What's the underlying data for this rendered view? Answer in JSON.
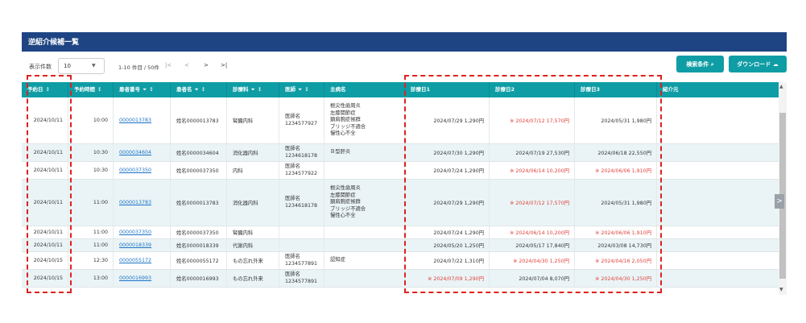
{
  "header": {
    "title": "逆紹介候補一覧"
  },
  "toolbar": {
    "page_size_label": "表示件数",
    "page_size_value": "10",
    "range_text": "1-10 件目 / 50件",
    "search_button": "検索条件",
    "download_button": "ダウンロード"
  },
  "columns": [
    "予約日",
    "予約時間",
    "患者番号",
    "患者名",
    "診療科",
    "医師",
    "主病名",
    "診療日1",
    "診療日2",
    "診療日3",
    "紹介元"
  ],
  "rows": [
    {
      "date": "2024/10/11",
      "time": "10:00",
      "pid": "0000013783",
      "name": "姓名0000013783",
      "dept": "腎臓内科",
      "doctor": [
        "医師名",
        "1234577927"
      ],
      "diag": [
        "根尖性歯周炎",
        "左膝関節症",
        "頚肩腕症候群",
        "ブリッジ不適合",
        "慢性心不全"
      ],
      "d1": "2024/07/29 1,290円",
      "d1r": false,
      "d2": "※ 2024/07/12 17,570円",
      "d2r": true,
      "d3": "2024/05/31 1,980円",
      "d3r": false
    },
    {
      "date": "2024/10/11",
      "time": "10:30",
      "pid": "0000034604",
      "name": "姓名0000034604",
      "dept": "消化器内科",
      "doctor": [
        "医師名",
        "1234618178"
      ],
      "diag": [
        "Ｂ型肝炎"
      ],
      "d1": "2024/07/30 1,290円",
      "d1r": false,
      "d2": "2024/07/19 27,530円",
      "d2r": false,
      "d3": "2024/06/18 22,550円",
      "d3r": false
    },
    {
      "date": "2024/10/11",
      "time": "10:30",
      "pid": "0000037350",
      "name": "姓名0000037350",
      "dept": "内科",
      "doctor": [
        "医師名",
        "1234577922"
      ],
      "diag": [],
      "d1": "2024/07/24 1,290円",
      "d1r": false,
      "d2": "※ 2024/06/14 10,200円",
      "d2r": true,
      "d3": "※ 2024/06/06 1,910円",
      "d3r": true
    },
    {
      "date": "2024/10/11",
      "time": "11:00",
      "pid": "0000013783",
      "name": "姓名0000013783",
      "dept": "消化器内科",
      "doctor": [
        "医師名",
        "1234618178"
      ],
      "diag": [
        "根尖性歯周炎",
        "左膝関節症",
        "頚肩腕症候群",
        "ブリッジ不適合",
        "慢性心不全"
      ],
      "d1": "2024/07/29 1,290円",
      "d1r": false,
      "d2": "※ 2024/07/12 17,570円",
      "d2r": true,
      "d3": "2024/05/31 1,980円",
      "d3r": false
    },
    {
      "date": "2024/10/11",
      "time": "11:00",
      "pid": "0000037350",
      "name": "姓名0000037350",
      "dept": "腎臓内科",
      "doctor": [],
      "diag": [],
      "d1": "2024/07/24 1,290円",
      "d1r": false,
      "d2": "※ 2024/06/14 10,200円",
      "d2r": true,
      "d3": "※ 2024/06/06 1,910円",
      "d3r": true
    },
    {
      "date": "2024/10/11",
      "time": "11:00",
      "pid": "0000018339",
      "name": "姓名0000018339",
      "dept": "代謝内科",
      "doctor": [],
      "diag": [],
      "d1": "2024/05/20 1,250円",
      "d1r": false,
      "d2": "2024/05/17 17,840円",
      "d2r": false,
      "d3": "2024/03/08 14,730円",
      "d3r": false
    },
    {
      "date": "2024/10/15",
      "time": "12:30",
      "pid": "0000055172",
      "name": "姓名0000055172",
      "dept": "もの忘れ外来",
      "doctor": [
        "医師名",
        "1234577891"
      ],
      "diag": [
        "認知症"
      ],
      "d1": "2024/07/22 1,310円",
      "d1r": false,
      "d2": "※ 2024/04/30 1,250円",
      "d2r": true,
      "d3": "※ 2024/04/16 2,050円",
      "d3r": true
    },
    {
      "date": "2024/10/15",
      "time": "13:00",
      "pid": "0000016993",
      "name": "姓名0000016993",
      "dept": "もの忘れ外来",
      "doctor": [
        "医師名",
        "1234577891"
      ],
      "diag": [],
      "d1": "※ 2024/07/09 1,290円",
      "d1r": true,
      "d2": "2024/07/04 8,070円",
      "d2r": false,
      "d3": "※ 2024/04/30 1,250円",
      "d3r": true
    }
  ],
  "colors": {
    "header": "#1e4483",
    "accent": "#0f9da5",
    "alert": "#e0413b",
    "link": "#1b72c6"
  }
}
